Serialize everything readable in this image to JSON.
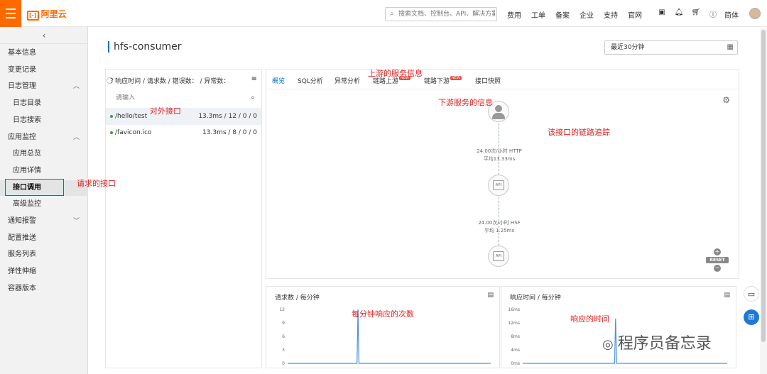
{
  "topbar": {
    "logo_text": "阿里云",
    "search_placeholder": "搜索文档、控制台、API、解决方案和资源",
    "nav": [
      "费用",
      "工单",
      "备案",
      "企业",
      "支持",
      "官网"
    ],
    "lang": "简体"
  },
  "sidebar": {
    "items": [
      {
        "label": "基本信息",
        "level": 0
      },
      {
        "label": "变更记录",
        "level": 0
      },
      {
        "label": "日志管理",
        "level": 0,
        "chev": "up"
      },
      {
        "label": "日志目录",
        "level": 1
      },
      {
        "label": "日志搜索",
        "level": 1
      },
      {
        "label": "应用监控",
        "level": 0,
        "chev": "up"
      },
      {
        "label": "应用总览",
        "level": 1
      },
      {
        "label": "应用详情",
        "level": 1
      },
      {
        "label": "接口调用",
        "level": 1,
        "active": true
      },
      {
        "label": "高级监控",
        "level": 1
      },
      {
        "label": "通知报警",
        "level": 0,
        "chev": "down"
      },
      {
        "label": "配置推送",
        "level": 0
      },
      {
        "label": "服务列表",
        "level": 0
      },
      {
        "label": "弹性伸缩",
        "level": 0
      },
      {
        "label": "容器版本",
        "level": 0
      }
    ]
  },
  "page": {
    "title": "hfs-consumer",
    "time_range": "最近30分钟"
  },
  "endpoint_list": {
    "header": "响应时间 / 请求数 / 错误数： / 异常数：",
    "search_placeholder": "请输入",
    "rows": [
      {
        "path": "/hello/test",
        "stats": "13.3ms / 12 / 0 / 0",
        "selected": true
      },
      {
        "path": "/favicon.ico",
        "stats": "13.3ms / 8 / 0 / 0",
        "selected": false
      }
    ]
  },
  "detail": {
    "tabs": [
      {
        "label": "概览",
        "active": true,
        "badge": ""
      },
      {
        "label": "SQL分析",
        "active": false,
        "badge": ""
      },
      {
        "label": "异常分析",
        "active": false,
        "badge": ""
      },
      {
        "label": "链路上游",
        "active": false,
        "badge": "NEW"
      },
      {
        "label": "链路下游",
        "active": false,
        "badge": "NEW"
      },
      {
        "label": "接口快照",
        "active": false,
        "badge": ""
      }
    ],
    "edge1": {
      "rate": "24.00次/小时 HTTP",
      "avg": "平均13.33ms"
    },
    "edge2": {
      "rate": "24.00次/小时 HSF",
      "avg": "平均 1.25ms"
    },
    "node_label": "API",
    "reset_label": "RESET"
  },
  "charts": {
    "colors": {
      "line": "#4a90e2"
    }
  },
  "chart_data": [
    {
      "type": "line",
      "title": "请求数 / 每分钟",
      "ylim": [
        0,
        12
      ],
      "yticks": [
        "12",
        "9",
        "6",
        "3",
        "0"
      ],
      "series": [
        {
          "values": [
            0,
            0,
            0,
            0,
            0,
            0,
            0,
            0,
            0,
            0,
            0,
            0,
            0,
            0,
            0,
            0,
            0,
            0,
            0,
            0,
            0,
            0,
            0,
            0,
            0,
            0,
            0,
            0,
            0,
            0,
            0,
            0,
            0,
            0,
            0,
            0,
            0,
            0,
            0,
            0,
            0,
            0,
            0,
            0,
            0,
            0,
            0,
            0,
            0,
            0,
            0,
            0,
            0,
            0,
            0,
            0,
            0,
            0,
            0,
            0,
            0,
            0,
            0,
            0,
            0,
            0,
            0,
            0,
            0,
            0,
            0,
            12,
            0,
            0,
            0,
            0,
            0,
            0,
            0,
            0,
            0,
            0,
            0,
            0,
            0,
            0,
            0,
            0,
            0,
            0,
            0,
            0,
            0,
            0,
            0,
            0,
            0,
            0,
            0,
            0,
            0,
            0,
            0,
            0,
            0,
            0,
            0,
            0,
            0,
            0,
            0,
            0,
            0,
            0,
            0,
            0,
            0,
            0,
            0,
            0,
            0,
            0,
            0,
            0,
            0,
            0,
            0,
            0,
            0,
            0,
            0,
            0,
            0,
            0,
            0,
            0,
            0,
            0,
            0,
            0,
            0,
            0,
            0,
            0,
            0,
            0,
            0,
            0,
            0,
            0,
            0,
            0,
            0,
            0,
            0,
            0,
            0,
            0,
            0,
            0,
            0,
            0,
            0,
            0,
            0,
            0,
            0,
            0,
            0,
            0,
            0,
            0,
            0,
            0,
            0,
            0,
            0,
            0,
            0,
            0,
            0,
            0,
            0,
            0,
            0,
            0,
            0,
            0,
            0,
            0,
            0,
            0,
            0,
            0,
            0,
            0,
            0,
            0,
            0,
            0,
            0,
            0,
            0,
            0,
            0,
            0
          ]
        }
      ],
      "grid": false
    },
    {
      "type": "line",
      "title": "响应时间 / 每分钟",
      "ylim": [
        0,
        16
      ],
      "yticks": [
        "16ms",
        "12ms",
        "8ms",
        "4ms",
        "0ms"
      ],
      "series": [
        {
          "values": [
            0,
            0,
            0,
            0,
            0,
            0,
            0,
            0,
            0,
            0,
            0,
            0,
            0,
            0,
            0,
            0,
            0,
            0,
            0,
            0,
            0,
            0,
            0,
            0,
            0,
            0,
            0,
            0,
            0,
            0,
            0,
            0,
            0,
            0,
            0,
            0,
            0,
            0,
            0,
            0,
            0,
            0,
            0,
            0,
            0,
            0,
            0,
            0,
            0,
            0,
            0,
            0,
            0,
            0,
            0,
            0,
            0,
            0,
            0,
            0,
            0,
            0,
            0,
            0,
            0,
            0,
            0,
            0,
            0,
            0,
            0,
            0,
            0,
            0,
            0,
            0,
            0,
            0,
            0,
            0,
            0,
            0,
            0,
            0,
            0,
            0,
            0,
            0,
            0,
            0,
            0,
            0,
            0,
            0,
            0,
            0,
            0,
            0,
            0,
            0,
            0,
            0,
            0,
            0,
            0,
            0,
            0,
            0,
            0,
            0,
            0,
            0,
            0,
            0,
            0,
            0,
            0,
            0,
            0,
            0,
            0,
            0,
            0,
            0,
            0,
            0,
            0,
            0,
            0,
            0,
            0,
            0,
            0,
            0,
            0,
            0,
            0,
            0,
            0,
            0,
            0,
            0,
            0,
            0,
            0,
            0,
            0,
            0,
            0,
            0,
            0,
            0,
            0,
            0,
            0,
            0,
            0,
            0,
            0,
            0,
            0,
            0,
            0,
            0,
            0,
            0,
            0,
            0,
            0,
            0,
            0,
            0,
            0,
            0,
            0,
            0,
            0,
            0,
            0,
            0,
            0,
            0,
            0,
            0,
            0,
            0,
            0,
            0,
            0,
            0,
            0,
            0,
            0,
            0,
            0,
            0,
            0,
            0,
            0,
            0,
            0,
            0,
            0,
            0,
            0,
            0,
            0,
            0
          ]
        }
      ],
      "peak_value": 13.3,
      "grid": false
    }
  ],
  "annotations": {
    "upstream": "上游的服务信息",
    "downstream": "下游服务的信息",
    "external_api": "对外接口",
    "trace": "该接口的链路追踪",
    "requested_api": "请求的接口",
    "per_minute": "每分钟响应的次数",
    "response_time": "响应的时间"
  },
  "watermark": "程序员备忘录"
}
